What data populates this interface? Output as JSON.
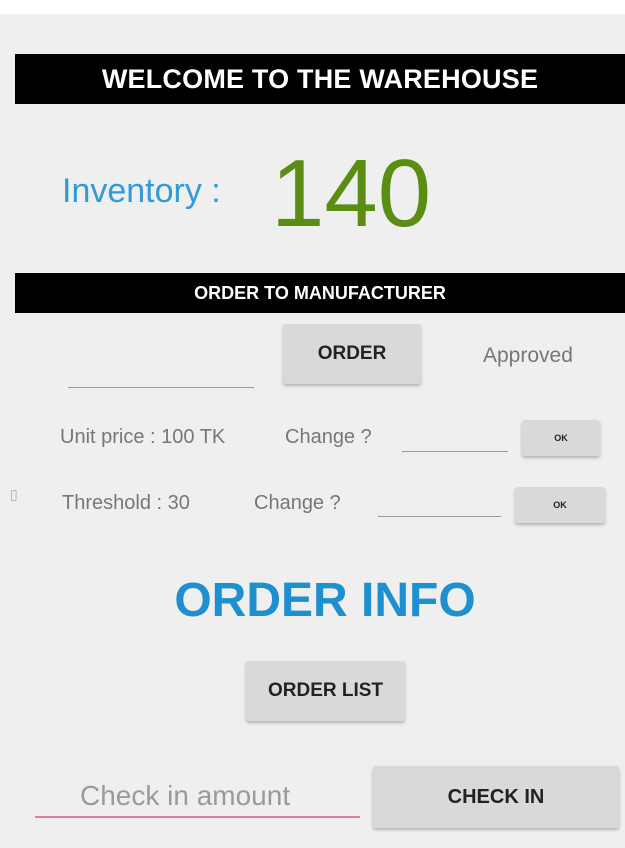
{
  "header": {
    "title": "WELCOME TO THE WAREHOUSE"
  },
  "inventory": {
    "label": "Inventory :",
    "value": "140"
  },
  "order_section": {
    "title": "ORDER TO MANUFACTURER",
    "quantity_field": {
      "value": "",
      "placeholder": ""
    },
    "order_button": "ORDER",
    "status_text": "Approved"
  },
  "unit_price": {
    "label": "Unit price : 100 TK",
    "change_label": "Change ?",
    "field_value": "",
    "ok_button": "OK"
  },
  "threshold": {
    "label": "Threshold : 30",
    "change_label": "Change ?",
    "field_value": "",
    "ok_button": "OK"
  },
  "order_info": {
    "title": "ORDER INFO",
    "order_list_button": "ORDER LIST"
  },
  "check_in": {
    "placeholder": "Check in amount",
    "value": "",
    "button": "CHECK IN"
  },
  "colors": {
    "inventory_label": "#2f9bd9",
    "inventory_value": "#5a8e13",
    "order_info_title": "#1e8fcf",
    "check_in_underline": "#e47aa3",
    "banner_background": "#000000",
    "button_background": "#d9d9d9"
  }
}
